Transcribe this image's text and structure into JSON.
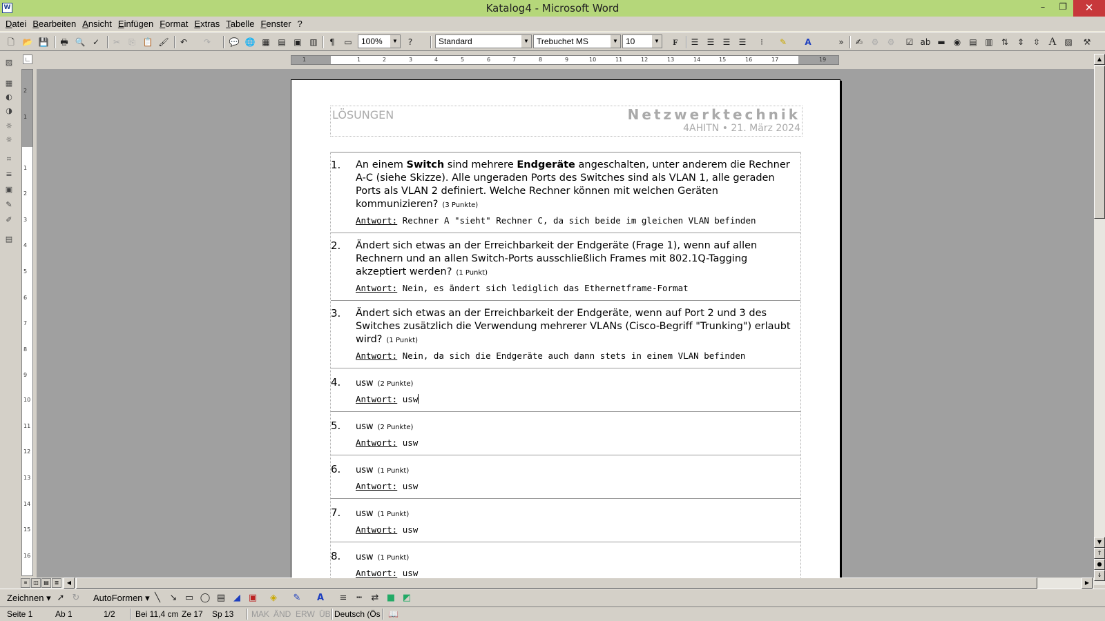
{
  "window": {
    "title": "Katalog4 - Microsoft Word",
    "app_icon": "W",
    "min": "–",
    "max": "❐",
    "close": "✕"
  },
  "menu": [
    "Datei",
    "Bearbeiten",
    "Ansicht",
    "Einfügen",
    "Format",
    "Extras",
    "Tabelle",
    "Fenster",
    "?"
  ],
  "toolbar": {
    "zoom": "100%",
    "style": "Standard",
    "font": "Trebuchet MS",
    "size": "10",
    "bold": "F"
  },
  "ruler_h": [
    "1",
    "1",
    "2",
    "3",
    "4",
    "5",
    "6",
    "7",
    "8",
    "9",
    "10",
    "11",
    "12",
    "13",
    "14",
    "15",
    "16",
    "17",
    "19"
  ],
  "ruler_v": [
    "2",
    "1",
    "1",
    "2",
    "3",
    "4",
    "5",
    "6",
    "7",
    "8",
    "9",
    "10",
    "11",
    "12",
    "13",
    "14",
    "15",
    "16"
  ],
  "header": {
    "left": "LÖSUNGEN",
    "right": "Netzwerktechnik",
    "sub": "4AHITN • 21. März 2024"
  },
  "answer_label": "Antwort:",
  "questions": [
    {
      "num": "1.",
      "pre": "An einem ",
      "b1": "Switch",
      "mid": " sind mehrere ",
      "b2": "Endgeräte",
      "post": " angeschalten, unter anderem die Rechner A-C (siehe Skizze). Alle ungeraden Ports des Switches sind als VLAN 1, alle geraden Ports als VLAN 2 definiert. Welche Rechner können mit welchen Geräten kommunizieren?",
      "points": "(3 Punkte)",
      "answer": "Rechner A \"sieht\" Rechner C, da sich beide im gleichen VLAN befinden"
    },
    {
      "num": "2.",
      "text": "Ändert sich etwas an der Erreichbarkeit der Endgeräte (Frage 1), wenn auf allen Rechnern und an allen Switch-Ports ausschließlich Frames mit 802.1Q-Tagging akzeptiert werden?",
      "points": "(1 Punkt)",
      "answer": "Nein, es ändert sich lediglich das Ethernetframe-Format"
    },
    {
      "num": "3.",
      "text": "Ändert sich etwas an der Erreichbarkeit der Endgeräte, wenn auf Port 2 und 3 des Switches zusätzlich die Verwendung mehrerer VLANs (Cisco-Begriff \"Trunking\") erlaubt wird?",
      "points": "(1 Punkt)",
      "answer": "Nein, da sich die Endgeräte auch dann stets in einem VLAN befinden"
    },
    {
      "num": "4.",
      "text": "usw",
      "points": "(2 Punkte)",
      "answer": "usw"
    },
    {
      "num": "5.",
      "text": "usw",
      "points": "(2 Punkte)",
      "answer": "usw"
    },
    {
      "num": "6.",
      "text": "usw",
      "points": "(1 Punkt)",
      "answer": "usw"
    },
    {
      "num": "7.",
      "text": "usw",
      "points": "(1 Punkt)",
      "answer": "usw"
    },
    {
      "num": "8.",
      "text": "usw",
      "points": "(1 Punkt)",
      "answer": "usw"
    }
  ],
  "drawbar": {
    "draw": "Zeichnen",
    "autoshapes": "AutoFormen"
  },
  "status": {
    "page": "Seite 1",
    "section": "Ab 1",
    "pages": "1/2",
    "at": "Bei 11,4 cm",
    "line": "Ze 17",
    "col": "Sp 13",
    "mak": "MAK",
    "and": "ÄND",
    "erw": "ERW",
    "ub": "ÜB",
    "lang": "Deutsch (Ös"
  }
}
